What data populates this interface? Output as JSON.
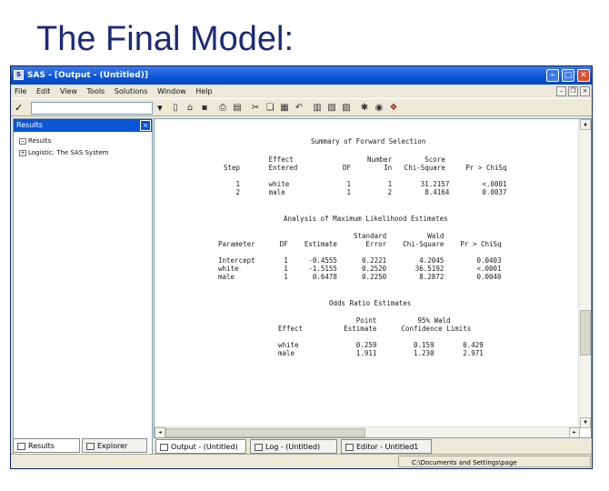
{
  "slide": {
    "title": "The Final Model:"
  },
  "window": {
    "title": "SAS - [Output - (Untitled)]",
    "icon": "sas-logo-icon",
    "buttons": {
      "minimize": "–",
      "maximize": "□",
      "close": "✕"
    }
  },
  "menu": [
    "File",
    "Edit",
    "View",
    "Tools",
    "Solutions",
    "Window",
    "Help"
  ],
  "toolbar": {
    "command_check": "✓",
    "command_value": "",
    "dropdown": "▼",
    "icons": [
      "new-icon",
      "open-icon",
      "save-icon",
      "print-icon",
      "print-preview-icon",
      "cut-icon",
      "copy-icon",
      "paste-icon",
      "undo-icon",
      "libraries-icon",
      "explorer-icon",
      "results-icon",
      "submit-icon",
      "help-icon",
      "options-icon"
    ]
  },
  "results": {
    "header": "Results",
    "close": "×",
    "tree": [
      {
        "toggle": "−",
        "label": "Results"
      },
      {
        "toggle": "+",
        "label": "Logistic: The SAS System"
      }
    ],
    "tabs": [
      {
        "label": "Results"
      },
      {
        "label": "Explorer"
      }
    ]
  },
  "output": {
    "forward": {
      "title": "Summary of Forward Selection",
      "header_row1": "           Effect                  Number        Score",
      "header_row2": "Step       Entered           DF        In   Chi-Square     Pr > ChiSq",
      "rows": [
        "   1       white              1         1       31.2157        <.0001",
        "   2       male               1         2        8.4164        0.0037"
      ]
    },
    "mle": {
      "title": "Analysis of Maximum Likelihood Estimates",
      "header_row1": "                                 Standard          Wald",
      "header_row2": "Parameter      DF    Estimate       Error    Chi-Square    Pr > ChiSq",
      "rows": [
        "Intercept       1     -0.4555      0.2221        4.2045        0.0403",
        "white           1     -1.5155      0.2520       36.5192        <.0001",
        "male            1      0.6478      0.2250        8.2872        0.0040"
      ]
    },
    "odds": {
      "title": "Odds Ratio Estimates",
      "header_row1": "                   Point          95% Wald",
      "header_row2": "Effect          Estimate      Confidence Limits",
      "rows": [
        "white              0.259         0.159       0.429",
        "male               1.911         1.230       2.971"
      ]
    }
  },
  "window_tabs": [
    {
      "label": "Output - (Untitled)"
    },
    {
      "label": "Log - (Untitled)"
    },
    {
      "label": "Editor - Untitled1"
    }
  ],
  "status": {
    "path": "C:\\Documents and Settings\\page"
  }
}
